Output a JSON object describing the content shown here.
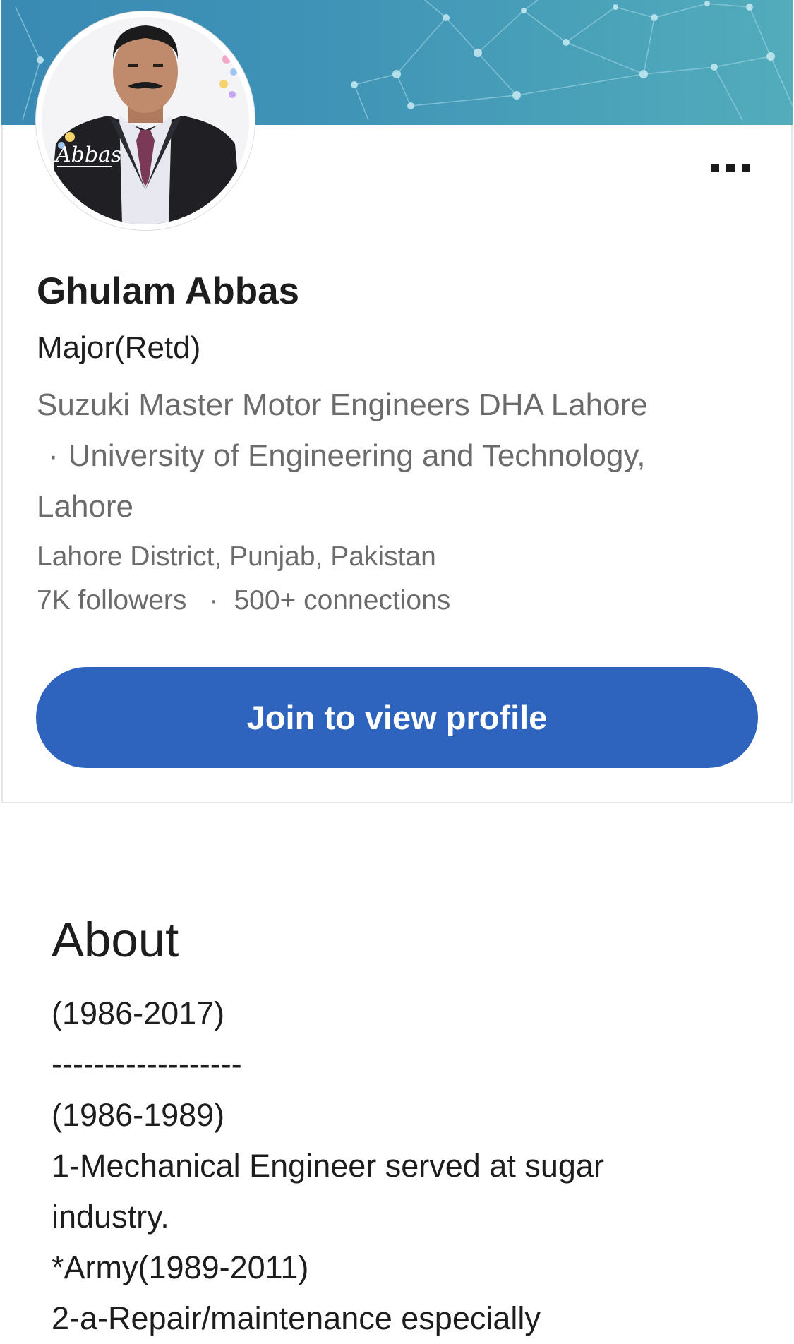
{
  "profile": {
    "name": "Ghulam Abbas",
    "headline": "Major(Retd)",
    "company": "Suzuki Master Motor Engineers DHA Lahore",
    "separator": "·",
    "education": "University of Engineering and Technology, Lahore",
    "location": "Lahore District, Punjab, Pakistan",
    "followers": "7K followers",
    "stats_separator": "·",
    "connections": "500+ connections",
    "avatar_caption": "Abbas"
  },
  "actions": {
    "more_icon": "more-horizontal-icon",
    "join_label": "Join to view profile"
  },
  "about": {
    "title": "About",
    "lines": [
      "(1986-2017)",
      "------------------",
      "(1986-1989)",
      "1-Mechanical Engineer served at sugar",
      "industry.",
      "*Army(1989-2011)",
      "2-a-Repair/maintenance especially"
    ]
  },
  "colors": {
    "banner": "#3f93b6",
    "primary_button": "#2e64be",
    "secondary_text": "#6b6b6b",
    "primary_text": "#1d1d1d"
  }
}
